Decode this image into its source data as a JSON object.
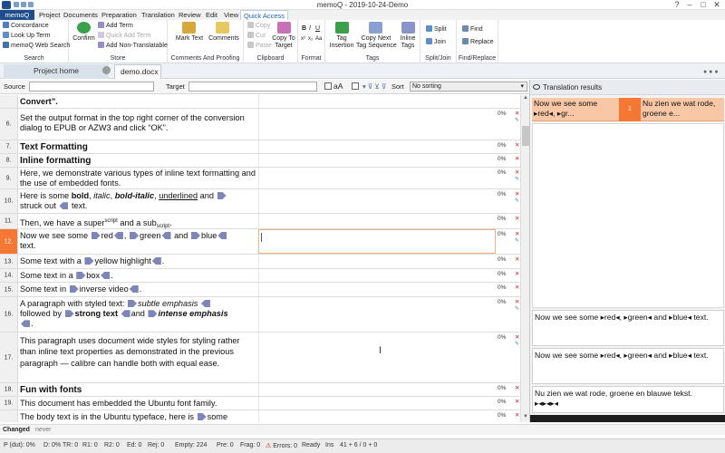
{
  "window": {
    "title": "memoQ - 2019-10-24-Demo",
    "controls": [
      "?",
      "–",
      "□",
      "✕"
    ]
  },
  "ribbon_tabs": [
    "memoQ",
    "Project",
    "Documents",
    "Preparation",
    "Translation",
    "Review",
    "Edit",
    "View",
    "Quick Access"
  ],
  "ribbon": {
    "search": {
      "label": "Search",
      "items": [
        "Concordance",
        "Look Up Term",
        "memoQ Web Search"
      ]
    },
    "store": {
      "label": "Store",
      "confirm": "Confirm",
      "items": [
        "Add Term",
        "Quick Add Term",
        "Add Non-Translatable"
      ]
    },
    "comments_proofing": {
      "label": "Comments And Proofing",
      "mark_text": "Mark Text",
      "comments": "Comments"
    },
    "clipboard": {
      "label": "Clipboard",
      "items": [
        "Copy",
        "Cut",
        "Paste"
      ],
      "copy_to_target_1": "Copy To",
      "copy_to_target_2": "Target"
    },
    "format": {
      "label": "Format",
      "row1": [
        "B",
        "I",
        "U"
      ],
      "row2": [
        "x²",
        "x₂",
        "Aa"
      ]
    },
    "tags": {
      "label": "Tags",
      "tag_insertion_1": "Tag",
      "tag_insertion_2": "Insertion",
      "copy_next_1": "Copy Next",
      "copy_next_2": "Tag Sequence",
      "inline_tags_1": "Inline",
      "inline_tags_2": "Tags"
    },
    "split_join": {
      "label": "Split/Join",
      "items": [
        "Split",
        "Join"
      ]
    },
    "find_replace": {
      "label": "Find/Replace",
      "items": [
        "Find",
        "Replace"
      ]
    }
  },
  "doc_tabs": {
    "home": "Project home",
    "doc": "demo.docx",
    "close": "x"
  },
  "filter": {
    "source_label": "Source",
    "target_label": "Target",
    "aa_label": "aA",
    "sort_label": "Sort",
    "sort_value": "No sorting"
  },
  "rows": [
    {
      "num": "",
      "pct": "",
      "text": "Convert”.",
      "bold": true
    },
    {
      "num": "6.",
      "pct": "0%",
      "text": "Set the output format in the top right corner of the conversion dialog to EPUB or AZW3 and click “OK”."
    },
    {
      "num": "7.",
      "pct": "0%",
      "text": "Text Formatting",
      "bold": true
    },
    {
      "num": "8.",
      "pct": "0%",
      "text": "Inline formatting",
      "bold": true
    },
    {
      "num": "9.",
      "pct": "0%",
      "text": "Here, we demonstrate various types of inline text formatting and the use of embedded fonts."
    },
    {
      "num": "10.",
      "pct": "0%",
      "p1": "Here is some ",
      "bold_word": "bold",
      "p2": ", ",
      "italic_word": "italic",
      "p3": ", ",
      "bolditalic_word": "bold-italic",
      "p4": ", ",
      "underline_word": "underlined",
      "p5": " and ",
      "p6": "struck out ",
      "p7": " text."
    },
    {
      "num": "11.",
      "pct": "0%",
      "p1": "Then, we have a super",
      "sup": "script",
      "p2": " and a sub",
      "sub": "script",
      "p3": "."
    },
    {
      "num": "12.",
      "pct": "0%",
      "p1": "Now we see some ",
      "w1": "red",
      "p2": ", ",
      "w2": "green",
      "p3": " and ",
      "w3": "blue",
      "p4": "text."
    },
    {
      "num": "13.",
      "pct": "0%",
      "p1": "Some text with a ",
      "w1": "yellow highlight",
      "p2": "."
    },
    {
      "num": "14.",
      "pct": "0%",
      "p1": "Some text in a ",
      "w1": "box",
      "p2": "."
    },
    {
      "num": "15.",
      "pct": "0%",
      "p1": "Some text in ",
      "w1": "inverse video",
      "p2": "."
    },
    {
      "num": "16.",
      "pct": "0%",
      "p1": "A paragraph with styled text: ",
      "w1": "subtle emphasis",
      "p2": "followed by ",
      "w2": "strong text",
      "p3": "and ",
      "w3": "intense emphasis",
      "p4": "."
    },
    {
      "num": "17.",
      "pct": "0%",
      "text": "This paragraph uses document wide styles for styling rather than inline text properties as demonstrated in the previous paragraph — calibre can handle both with equal ease."
    },
    {
      "num": "18.",
      "pct": "0%",
      "text": "Fun with fonts",
      "bold": true
    },
    {
      "num": "19.",
      "pct": "0%",
      "text": "This document has embedded the Ubuntu font family."
    },
    {
      "num": "",
      "pct": "0%",
      "p1": "The body text is in the Ubuntu typeface, here is ",
      "w1": "some"
    }
  ],
  "translation_results": {
    "title": "Translation results",
    "hit_source": "Now we see some ▸red◂, ▸gr...",
    "hit_number": "1",
    "hit_target": "Nu zien we wat rode, groene e...",
    "preview1": "Now we see some ▸red◂, ▸green◂ and ▸blue◂ text.",
    "preview2": "Now we see some ▸red◂, ▸green◂ and ▸blue◂ text.",
    "preview3a": "Nu zien we wat rode, groene en blauwe tekst.",
    "preview3b": "▸◂▸◂▸◂"
  },
  "changed_bar": {
    "label": "Changed",
    "value": "never"
  },
  "status": [
    "P (dut): 0%",
    "D: 0%",
    "TR: 0",
    "R1: 0",
    "R2: 0",
    "Ed: 0",
    "Rej: 0",
    "Empty: 224",
    "Pre: 0",
    "Frag: 0",
    "Errors: 0",
    "Ready",
    "Ins",
    "41 + 6 / 0 + 0"
  ],
  "colors": {
    "accent": "#1e4f8c",
    "active_row": "#f47834",
    "hit": "#f8c7a6",
    "tag": "#7e86b8"
  }
}
